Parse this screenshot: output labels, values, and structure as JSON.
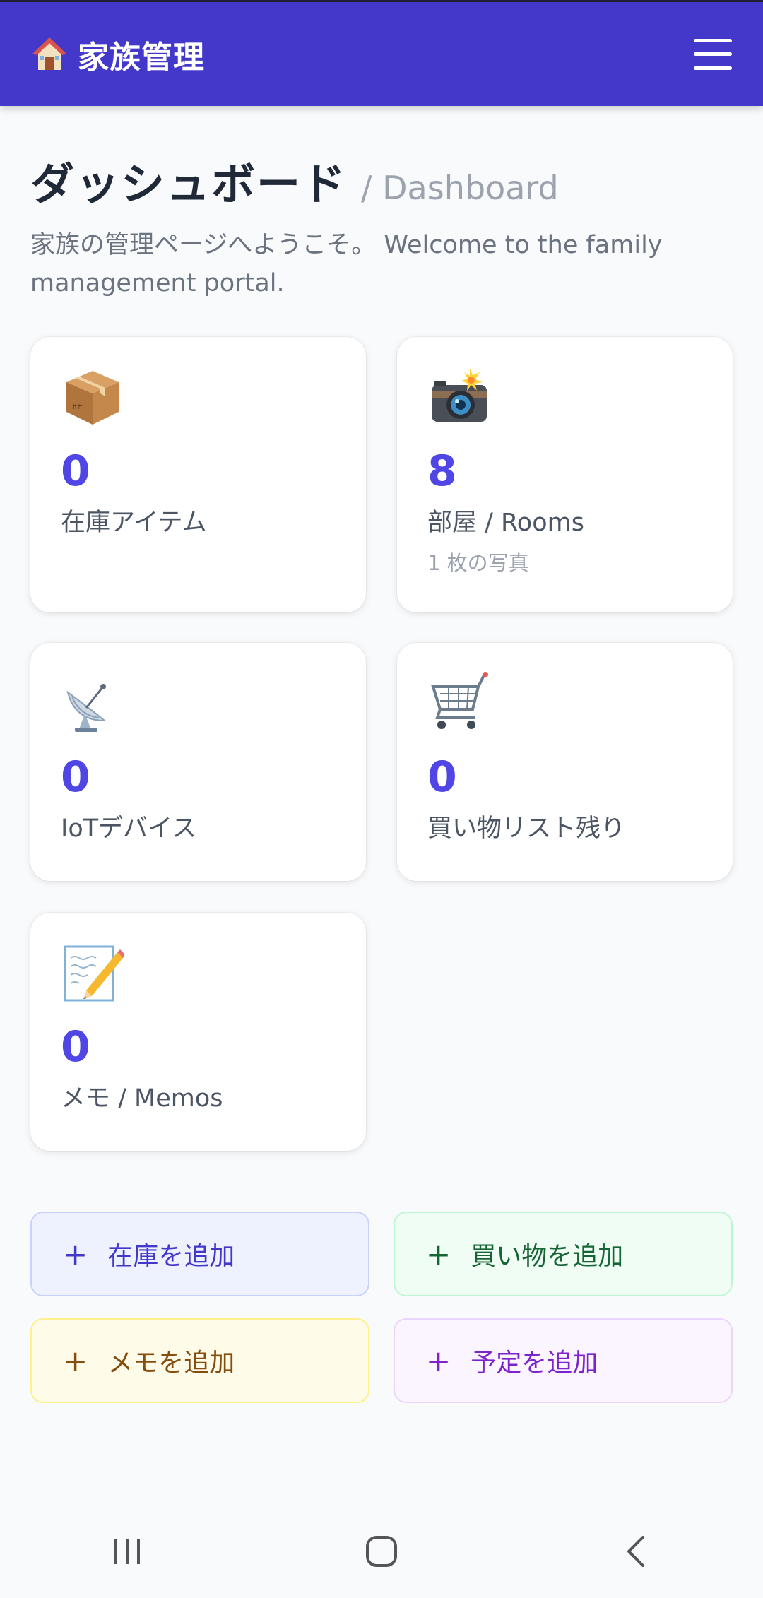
{
  "app": {
    "title": "家族管理",
    "brand_icon": "house-icon",
    "menu_icon": "hamburger-menu-icon"
  },
  "header": {
    "title": "ダッシュボード",
    "title_en": "/ Dashboard",
    "description": "家族の管理ページへようこそ。 Welcome to the family management portal."
  },
  "cards": [
    {
      "icon": "package-icon",
      "value": "0",
      "label": "在庫アイテム"
    },
    {
      "icon": "camera-icon",
      "value": "8",
      "label": "部屋 / Rooms",
      "sub": "1 枚の写真"
    },
    {
      "icon": "satellite-dish-icon",
      "value": "0",
      "label": "IoTデバイス"
    },
    {
      "icon": "shopping-cart-icon",
      "value": "0",
      "label": "買い物リスト残り"
    },
    {
      "icon": "memo-icon",
      "value": "0",
      "label": "メモ / Memos"
    }
  ],
  "actions": [
    {
      "plus": "+",
      "label": "在庫を追加",
      "color": "#4338ca"
    },
    {
      "plus": "+",
      "label": "買い物を追加",
      "color": "#166534"
    },
    {
      "plus": "+",
      "label": "メモを追加",
      "color": "#854d0e"
    },
    {
      "plus": "+",
      "label": "予定を追加",
      "color": "#7e22ce"
    }
  ],
  "theme": {
    "accent": "#4338ca",
    "value_color": "#4f46e5"
  },
  "system_nav": {
    "recents_icon": "recents-icon",
    "home_icon": "home-icon",
    "back_icon": "back-icon"
  }
}
